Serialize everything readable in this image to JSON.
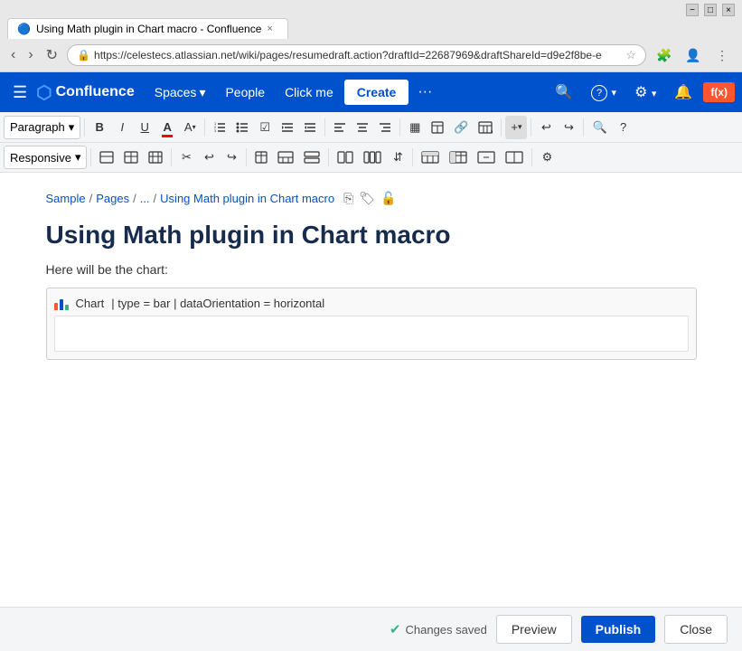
{
  "browser": {
    "tab_title": "Using Math plugin in Chart macro - Confluence",
    "url": "https://celestecs.atlassian.net/wiki/pages/resumedraft.action?draftId=22687969&draftShareId=d9e2f8be-e",
    "close_label": "×",
    "minimize_label": "−",
    "maximize_label": "□"
  },
  "nav": {
    "hamburger": "☰",
    "logo_text": "Confluence",
    "spaces_label": "Spaces",
    "people_label": "People",
    "click_me_label": "Click me",
    "create_label": "Create",
    "more_label": "···",
    "search_label": "🔍",
    "help_label": "?",
    "settings_label": "⚙",
    "notifications_label": "🔔",
    "fx_label": "f(x)"
  },
  "toolbar": {
    "paragraph_label": "Paragraph",
    "dropdown_arrow": "▾",
    "bold_label": "B",
    "italic_label": "I",
    "underline_label": "U",
    "color_label": "A",
    "size_label": "A²",
    "list_ordered": "≡",
    "list_unordered": "≡",
    "task_label": "☑",
    "indent_in": "⇥",
    "indent_out": "⇤",
    "align_left": "≡",
    "align_center": "≡",
    "align_right": "≡",
    "layout_label": "▦",
    "more1_label": "+",
    "undo_label": "↩",
    "redo_label": "↪",
    "insert_label": "+",
    "responsive_label": "Responsive",
    "search_toolbar": "🔍",
    "help_toolbar": "?"
  },
  "breadcrumb": {
    "sample": "Sample",
    "sep1": "/",
    "pages": "Pages",
    "sep2": "/",
    "ellipsis": "...",
    "sep3": "/",
    "current": "Using Math plugin in Chart macro"
  },
  "page": {
    "title": "Using Math plugin in Chart macro",
    "body_text": "Here will be the chart:",
    "macro_label": "Chart",
    "macro_params": "| type = bar | dataOrientation = horizontal"
  },
  "bottom_bar": {
    "changes_saved": "Changes saved",
    "preview_label": "Preview",
    "publish_label": "Publish",
    "close_label": "Close"
  }
}
